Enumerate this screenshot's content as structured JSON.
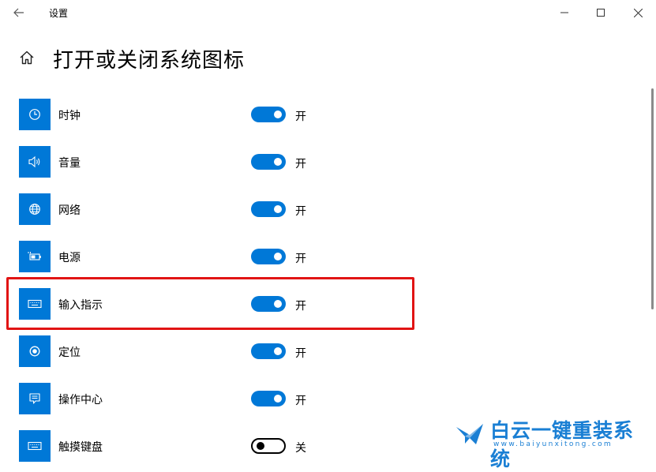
{
  "window": {
    "title": "设置",
    "back_icon": "back-arrow-icon",
    "controls": [
      "minimize",
      "maximize",
      "close"
    ]
  },
  "page": {
    "title": "打开或关闭系统图标",
    "home_icon": "home-icon"
  },
  "items": [
    {
      "label": "时钟",
      "icon": "clock-icon",
      "state": "on",
      "state_label": "开"
    },
    {
      "label": "音量",
      "icon": "volume-icon",
      "state": "on",
      "state_label": "开"
    },
    {
      "label": "网络",
      "icon": "globe-icon",
      "state": "on",
      "state_label": "开"
    },
    {
      "label": "电源",
      "icon": "battery-plug-icon",
      "state": "on",
      "state_label": "开"
    },
    {
      "label": "输入指示",
      "icon": "keyboard-icon",
      "state": "on",
      "state_label": "开",
      "highlighted": true
    },
    {
      "label": "定位",
      "icon": "location-icon",
      "state": "on",
      "state_label": "开"
    },
    {
      "label": "操作中心",
      "icon": "action-center-icon",
      "state": "on",
      "state_label": "开"
    },
    {
      "label": "触摸键盘",
      "icon": "keyboard-icon",
      "state": "off",
      "state_label": "关"
    }
  ],
  "colors": {
    "accent": "#0078d7",
    "highlight": "#e11414"
  },
  "watermark": {
    "text": "白云一键重装系统",
    "url": "www.baiyunxitong.com"
  }
}
